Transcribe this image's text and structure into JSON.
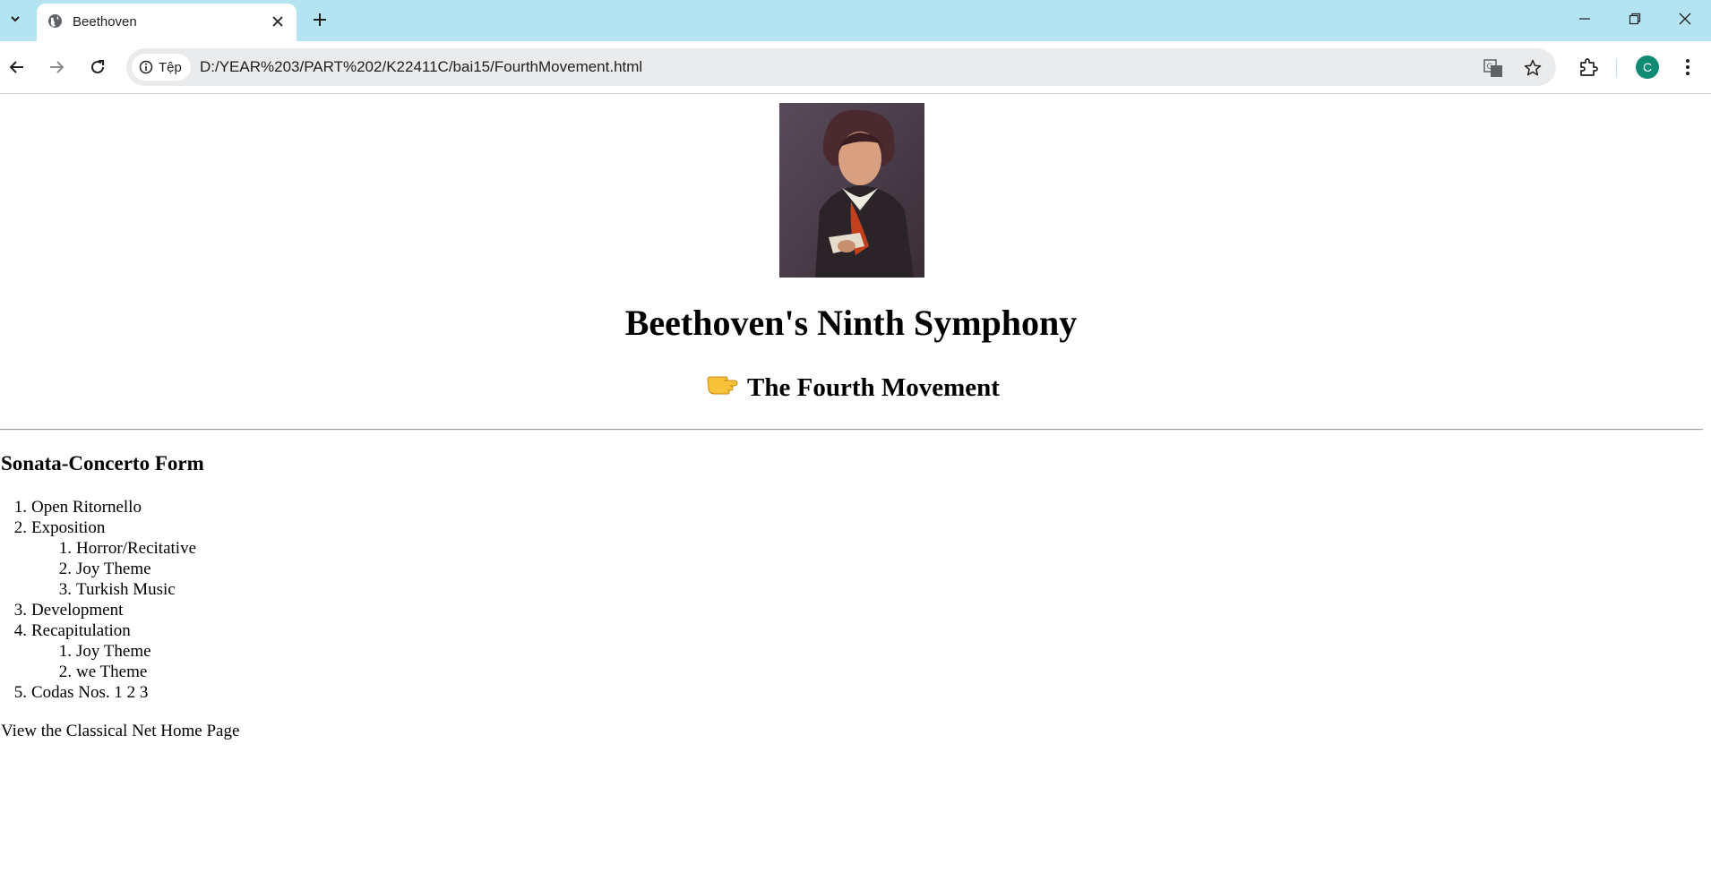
{
  "browser": {
    "tab_title": "Beethoven",
    "site_chip_label": "Tệp",
    "url": "D:/YEAR%203/PART%202/K22411C/bai15/FourthMovement.html",
    "profile_initial": "C",
    "colors": {
      "tabstrip": "#b4e3f1",
      "omnibox": "#e9ebec",
      "avatar": "#0f8a73"
    }
  },
  "page": {
    "title": "Beethoven's Ninth Symphony",
    "subtitle": "The Fourth Movement",
    "section_heading": "Sonata-Concerto Form",
    "outline": [
      {
        "number": "1.",
        "label": "Open Ritornello"
      },
      {
        "number": "2.",
        "label": "Exposition",
        "children": [
          {
            "number": "1.",
            "label": "Horror/Recitative"
          },
          {
            "number": "2.",
            "label": "Joy Theme"
          },
          {
            "number": "3.",
            "label": "Turkish Music"
          }
        ]
      },
      {
        "number": "3.",
        "label": "Development"
      },
      {
        "number": "4.",
        "label": "Recapitulation",
        "children": [
          {
            "number": "1.",
            "label": "Joy Theme"
          },
          {
            "number": "2.",
            "label": "we Theme"
          }
        ]
      },
      {
        "number": "5.",
        "label": "Codas Nos. 1 2 3"
      }
    ],
    "footer_link": "View the Classical Net Home Page"
  }
}
